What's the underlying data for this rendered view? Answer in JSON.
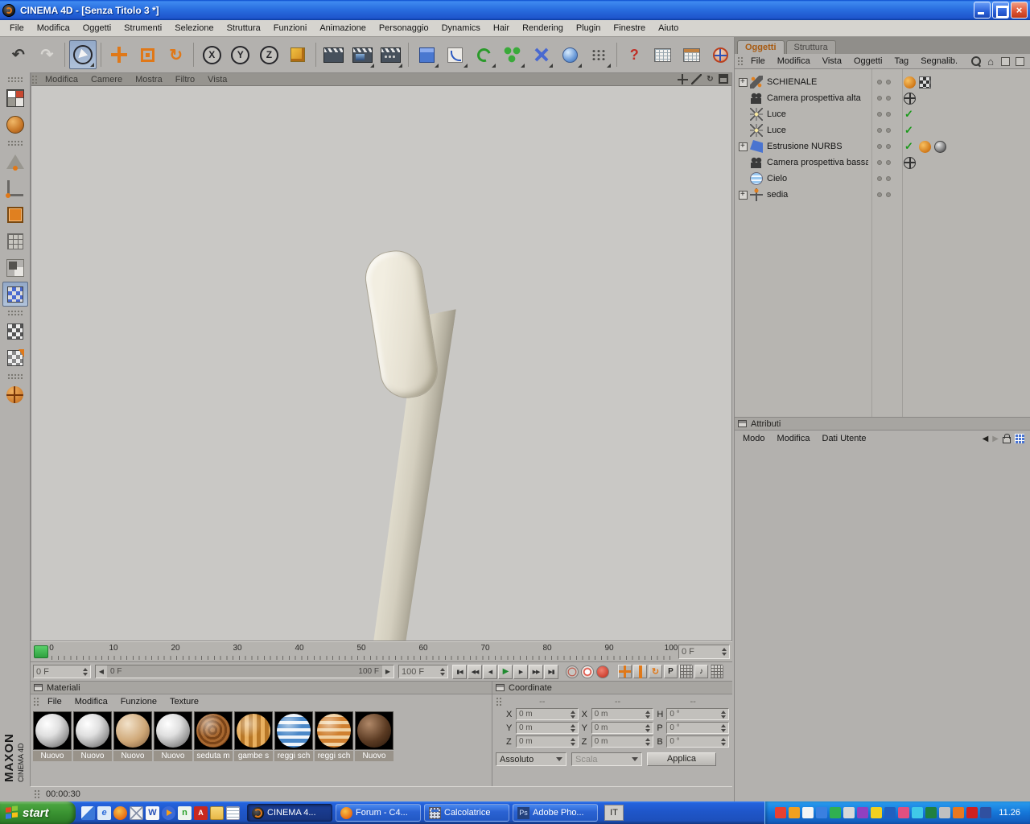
{
  "window": {
    "title": "CINEMA 4D - [Senza Titolo 3 *]"
  },
  "menubar": {
    "items": [
      "File",
      "Modifica",
      "Oggetti",
      "Strumenti",
      "Selezione",
      "Struttura",
      "Funzioni",
      "Animazione",
      "Personaggio",
      "Dynamics",
      "Hair",
      "Rendering",
      "Plugin",
      "Finestre",
      "Aiuto"
    ]
  },
  "toolbar": {
    "lock_x": "X",
    "lock_y": "Y",
    "lock_z": "Z",
    "help": "?"
  },
  "viewport": {
    "menu": [
      "Modifica",
      "Camere",
      "Mostra",
      "Filtro",
      "Vista"
    ]
  },
  "timeline": {
    "ticks": [
      "0",
      "10",
      "20",
      "30",
      "40",
      "50",
      "60",
      "70",
      "80",
      "90",
      "100"
    ],
    "frame_field": "0 F",
    "start_field": "0 F",
    "slider_left": "0 F",
    "slider_right": "100 F",
    "end_field": "100 F",
    "record_parameter": "P"
  },
  "materials": {
    "title": "Materiali",
    "menu": [
      "File",
      "Modifica",
      "Funzione",
      "Texture"
    ],
    "items": [
      {
        "label": "Nuovo",
        "variant": "white"
      },
      {
        "label": "Nuovo",
        "variant": "white"
      },
      {
        "label": "Nuovo",
        "variant": "beige"
      },
      {
        "label": "Nuovo",
        "variant": "white"
      },
      {
        "label": "seduta m",
        "variant": "wood"
      },
      {
        "label": "gambe s",
        "variant": "stripes-tan"
      },
      {
        "label": "reggi sch",
        "variant": "stripes-blue"
      },
      {
        "label": "reggi sch",
        "variant": "stripes-orange"
      },
      {
        "label": "Nuovo",
        "variant": "brown"
      }
    ]
  },
  "coordinates": {
    "title": "Coordinate",
    "headers": [
      "--",
      "--",
      "--"
    ],
    "pos": {
      "x_label": "X",
      "x": "0 m",
      "y_label": "Y",
      "y": "0 m",
      "z_label": "Z",
      "z": "0 m"
    },
    "size": {
      "x_label": "X",
      "x": "0 m",
      "y_label": "Y",
      "y": "0 m",
      "z_label": "Z",
      "z": "0 m"
    },
    "rot": {
      "h_label": "H",
      "h": "0 °",
      "p_label": "P",
      "p": "0 °",
      "b_label": "B",
      "b": "0 °"
    },
    "mode": "Assoluto",
    "scale_mode": "Scala",
    "apply": "Applica"
  },
  "object_manager": {
    "tabs": [
      {
        "label": "Oggetti"
      },
      {
        "label": "Struttura"
      }
    ],
    "menu": [
      "File",
      "Modifica",
      "Vista",
      "Oggetti",
      "Tag",
      "Segnalib."
    ],
    "objects": [
      {
        "label": "SCHIENALE",
        "icon": "bone",
        "tags": [
          "phong",
          "checker"
        ]
      },
      {
        "label": "Camera prospettiva alta",
        "icon": "camera",
        "tags": [
          "target"
        ]
      },
      {
        "label": "Luce",
        "icon": "light",
        "tags": [
          "check"
        ]
      },
      {
        "label": "Luce",
        "icon": "light",
        "tags": [
          "check"
        ]
      },
      {
        "label": "Estrusione NURBS",
        "icon": "extrude",
        "tags": [
          "check",
          "phong",
          "sphere"
        ]
      },
      {
        "label": "Camera prospettiva bassa",
        "icon": "camera",
        "tags": [
          "target"
        ]
      },
      {
        "label": "Cielo",
        "icon": "sky",
        "tags": []
      },
      {
        "label": "sedia",
        "icon": "null",
        "tags": []
      }
    ]
  },
  "attributes": {
    "title": "Attributi",
    "menu": [
      "Modo",
      "Modifica",
      "Dati Utente"
    ]
  },
  "statusbar": {
    "time": "00:00:30"
  },
  "branding": {
    "maxon": "MAXON",
    "cinema": "CINEMA 4D"
  },
  "taskbar": {
    "start": "start",
    "quicklaunch": [
      "show-desktop",
      "ie",
      "firefox",
      "mail",
      "word",
      "media",
      "msn",
      "acrobat",
      "folder",
      "notes"
    ],
    "tasks": [
      {
        "label": "CINEMA 4...",
        "icon": "c4d",
        "active": true
      },
      {
        "label": "Forum - C4...",
        "icon": "firefox",
        "active": false
      },
      {
        "label": "Calcolatrice",
        "icon": "calculator",
        "active": false
      },
      {
        "label": "Adobe Pho...",
        "icon": "photoshop",
        "active": false
      }
    ],
    "lang": "IT",
    "clock": "11.26"
  }
}
